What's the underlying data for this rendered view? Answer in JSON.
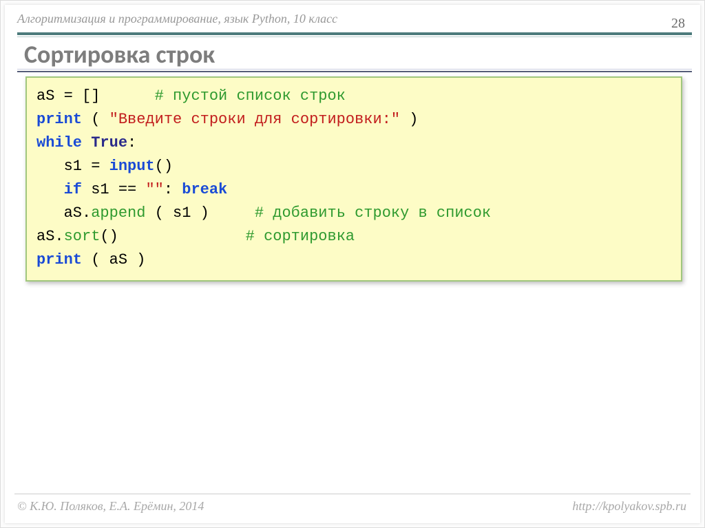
{
  "header": {
    "breadcrumb": "Алгоритмизация и программирование, язык Python, 10 класс",
    "page_number": "28"
  },
  "title": "Сортировка строк",
  "code": {
    "lines": [
      {
        "indent": "",
        "parts": [
          {
            "t": "aS",
            "c": ""
          },
          {
            "t": " = ",
            "c": ""
          },
          {
            "t": "[]",
            "c": ""
          },
          {
            "t": "      ",
            "c": ""
          },
          {
            "t": "# пустой список строк",
            "c": "k-comment"
          }
        ]
      },
      {
        "indent": "",
        "parts": [
          {
            "t": "print",
            "c": "k-blue"
          },
          {
            "t": " ( ",
            "c": ""
          },
          {
            "t": "\"Введите строки для сортировки:\"",
            "c": "k-red"
          },
          {
            "t": " )",
            "c": ""
          }
        ]
      },
      {
        "indent": "",
        "parts": [
          {
            "t": "while",
            "c": "k-blue"
          },
          {
            "t": " ",
            "c": ""
          },
          {
            "t": "True",
            "c": "k-navy"
          },
          {
            "t": ":",
            "c": ""
          }
        ]
      },
      {
        "indent": "   ",
        "parts": [
          {
            "t": "s1",
            "c": ""
          },
          {
            "t": " = ",
            "c": ""
          },
          {
            "t": "input",
            "c": "k-blue"
          },
          {
            "t": "()",
            "c": ""
          }
        ]
      },
      {
        "indent": "   ",
        "parts": [
          {
            "t": "if",
            "c": "k-blue"
          },
          {
            "t": " s1 == ",
            "c": ""
          },
          {
            "t": "\"\"",
            "c": "k-red"
          },
          {
            "t": ": ",
            "c": ""
          },
          {
            "t": "break",
            "c": "k-blue"
          }
        ]
      },
      {
        "indent": "   ",
        "parts": [
          {
            "t": "aS.",
            "c": ""
          },
          {
            "t": "append",
            "c": "k-method"
          },
          {
            "t": " ( s1 )",
            "c": ""
          },
          {
            "t": "     ",
            "c": ""
          },
          {
            "t": "# добавить строку в список",
            "c": "k-comment"
          }
        ]
      },
      {
        "indent": "",
        "parts": [
          {
            "t": "aS.",
            "c": ""
          },
          {
            "t": "sort",
            "c": "k-method"
          },
          {
            "t": "()",
            "c": ""
          },
          {
            "t": "              ",
            "c": ""
          },
          {
            "t": "# сортировка",
            "c": "k-comment"
          }
        ]
      },
      {
        "indent": "",
        "parts": [
          {
            "t": "print",
            "c": "k-blue"
          },
          {
            "t": " ( aS )",
            "c": ""
          }
        ]
      }
    ]
  },
  "footer": {
    "left": "© К.Ю. Поляков, Е.А. Ерёмин, 2014",
    "right": "http://kpolyakov.spb.ru"
  }
}
